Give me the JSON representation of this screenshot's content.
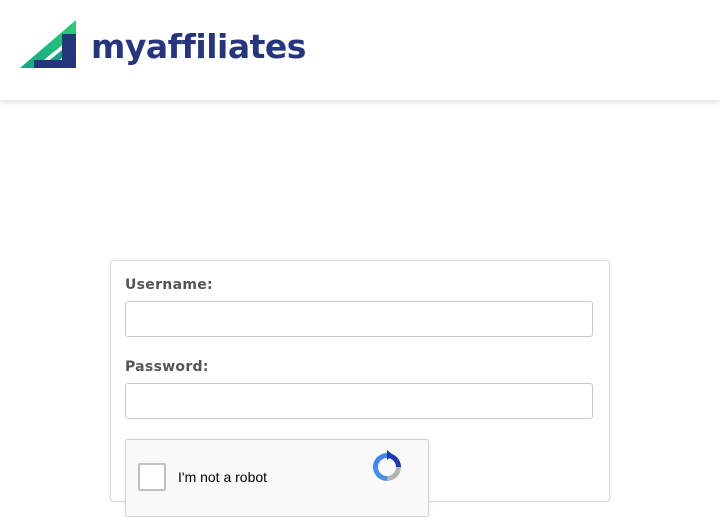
{
  "header": {
    "brand_name": "myaffiliates",
    "colors": {
      "brand_navy": "#27357c",
      "brand_green": "#1fbf8f",
      "brand_teal": "#1b9a8a"
    }
  },
  "login_form": {
    "username_label": "Username:",
    "username_value": "",
    "password_label": "Password:",
    "password_value": "",
    "captcha": {
      "label": "I'm not a robot",
      "checked": false,
      "icon": "recaptcha-icon"
    }
  }
}
